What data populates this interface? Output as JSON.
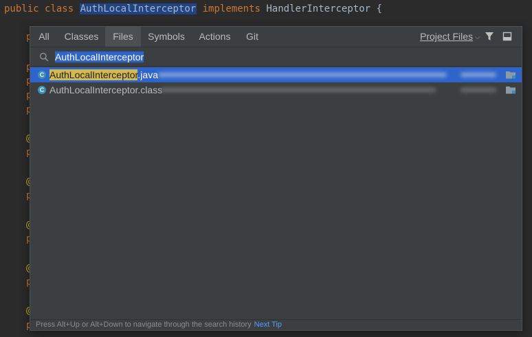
{
  "editor": {
    "code_top": {
      "kw_public": "public",
      "kw_class": "class",
      "class_name": "AuthLocalInterceptor",
      "kw_implements": "implements",
      "iface": "HandlerInterceptor {"
    },
    "gutter_p": "p",
    "gutter_at": "@"
  },
  "popup": {
    "tabs": [
      {
        "label": "All"
      },
      {
        "label": "Classes"
      },
      {
        "label": "Files"
      },
      {
        "label": "Symbols"
      },
      {
        "label": "Actions"
      },
      {
        "label": "Git"
      }
    ],
    "active_tab": "Files",
    "scope_label": "Project Files",
    "search": {
      "value": "AuthLocalInterceptor"
    },
    "results": [
      {
        "icon_letter": "C",
        "match": "AuthLocalInterceptor",
        "rest": ".java",
        "selected": true
      },
      {
        "icon_letter": "C",
        "match": "AuthLocalInterceptor",
        "rest": ".class",
        "selected": false
      }
    ],
    "footer": {
      "hint": "Press Alt+Up or Alt+Down to navigate through the search history",
      "next_tip": "Next Tip"
    }
  },
  "icons": {
    "filter": "filter-icon",
    "pin": "pin-window-icon",
    "search": "search-icon",
    "class_file": "class-icon",
    "folder": "folder-icon"
  },
  "colors": {
    "editor_bg": "#2b2b2b",
    "popup_bg": "#3c3f41",
    "selection": "#2f65ca",
    "match_highlight": "#d4b94c",
    "keyword": "#cc7832",
    "annotation": "#bbb529",
    "link": "#589df6"
  }
}
